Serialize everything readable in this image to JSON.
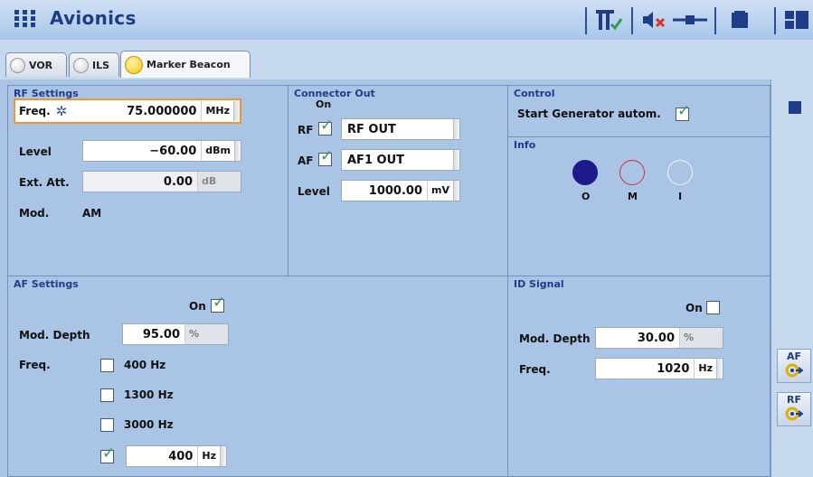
{
  "app": {
    "title": "Avionics"
  },
  "tabs": [
    {
      "label": "VOR"
    },
    {
      "label": "ILS"
    },
    {
      "label": "Marker Beacon"
    }
  ],
  "rf_settings": {
    "title": "RF Settings",
    "freq": {
      "label": "Freq.",
      "value": "75.000000",
      "unit": "MHz"
    },
    "level": {
      "label": "Level",
      "value": "−60.00",
      "unit": "dBm"
    },
    "ext_att": {
      "label": "Ext. Att.",
      "value": "0.00",
      "unit": "dB"
    },
    "mod": {
      "label": "Mod.",
      "value": "AM"
    }
  },
  "connector_out": {
    "title": "Connector Out",
    "on_header": "On",
    "rf": {
      "label": "RF",
      "value": "RF OUT",
      "checked": true
    },
    "af": {
      "label": "AF",
      "value": "AF1 OUT",
      "checked": true
    },
    "level": {
      "label": "Level",
      "value": "1000.00",
      "unit": "mV"
    }
  },
  "control": {
    "title": "Control",
    "start_generator": {
      "label": "Start Generator autom.",
      "checked": true
    }
  },
  "info": {
    "title": "Info",
    "indicators": [
      {
        "label": "O",
        "color": "#1e1a8c",
        "filled": true
      },
      {
        "label": "M",
        "color": "#d8322a",
        "filled": false
      },
      {
        "label": "I",
        "color": "#f4f6fa",
        "filled": false
      }
    ]
  },
  "af_settings": {
    "title": "AF Settings",
    "on": {
      "label": "On",
      "checked": true
    },
    "mod_depth": {
      "label": "Mod. Depth",
      "value": "95.00",
      "unit": "%"
    },
    "freq": {
      "label": "Freq."
    },
    "options": [
      {
        "label": "400 Hz",
        "checked": false
      },
      {
        "label": "1300 Hz",
        "checked": false
      },
      {
        "label": "3000 Hz",
        "checked": false
      }
    ],
    "custom": {
      "checked": true,
      "value": "400",
      "unit": "Hz"
    }
  },
  "id_signal": {
    "title": "ID Signal",
    "on": {
      "label": "On",
      "checked": false
    },
    "mod_depth": {
      "label": "Mod. Depth",
      "value": "30.00",
      "unit": "%"
    },
    "freq": {
      "label": "Freq.",
      "value": "1020",
      "unit": "Hz"
    }
  },
  "sidebar": {
    "af_button": "AF",
    "rf_button": "RF"
  },
  "colors": {
    "accent": "#1f3c86",
    "panel_bg": "#a9c4e4",
    "selection": "#f0962c",
    "check": "#2f9e4f"
  }
}
